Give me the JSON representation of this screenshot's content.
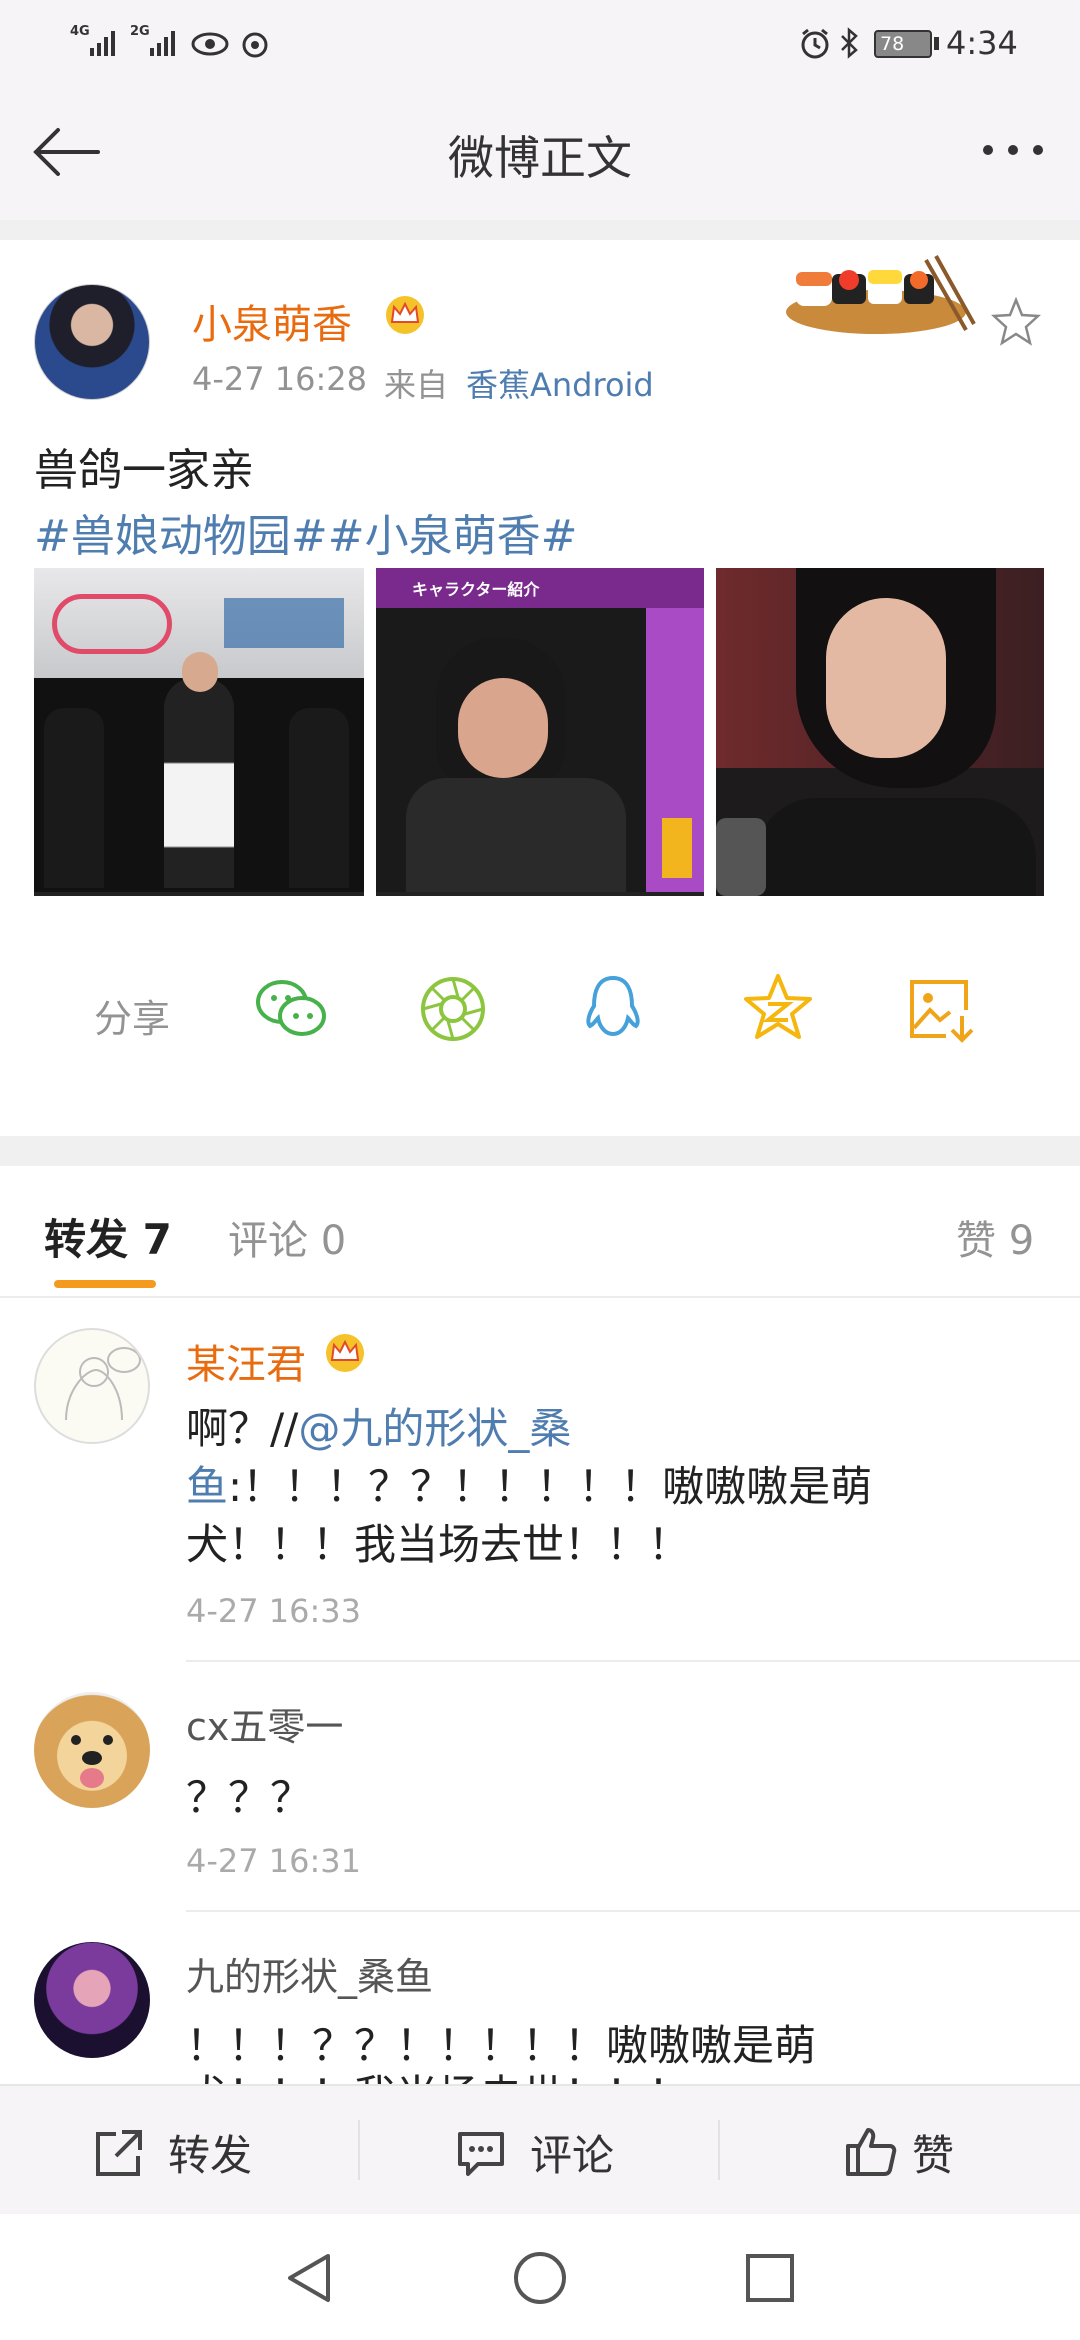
{
  "status_bar": {
    "signal1_label": "4G",
    "signal2_label": "2G",
    "battery": "78",
    "time": "4:34"
  },
  "header": {
    "title": "微博正文"
  },
  "post": {
    "author": "小泉萌香",
    "time": "4-27 16:28",
    "source_prefix": "来自",
    "source": "香蕉Android",
    "text_line1": "兽鸽一家亲",
    "hashtags": "#兽娘动物园##小泉萌香#",
    "image_captions": {
      "img2_banner": "キャラクター紹介"
    }
  },
  "share_row": {
    "label": "分享",
    "icons": [
      "wechat-icon",
      "moments-icon",
      "qq-icon",
      "qzone-icon",
      "save-image-icon"
    ]
  },
  "tabs": {
    "repost": "转发 7",
    "comment": "评论 0",
    "like": "赞 9"
  },
  "reposts": [
    {
      "user": "某汪君",
      "text_prefix": "啊？//",
      "mention": "@九的形状_桑鱼",
      "text_line1_rest": ":！！！？？！！！！！嗷嗷嗷是萌",
      "text_line2": "犬！！！我当场去世！！！",
      "time": "4-27 16:33"
    },
    {
      "user": "cx五零一",
      "text": "？？？",
      "time": "4-27 16:31"
    },
    {
      "user": "九的形状_桑鱼",
      "text": "！！！？？！！！！！嗷嗷嗷是萌",
      "text_cut": "犬！！！我当场去世！！！"
    }
  ],
  "bottom_bar": {
    "repost": "转发",
    "comment": "评论",
    "like": "赞"
  },
  "colors": {
    "accent_orange": "#e86b0f",
    "link_blue": "#507daf",
    "tab_underline": "#f49b1f",
    "wechat_green": "#47b24c",
    "moments_green": "#8cc63f",
    "qq_blue": "#46a0d9",
    "qzone_yellow": "#f5b60e",
    "save_orange": "#f0a419"
  }
}
